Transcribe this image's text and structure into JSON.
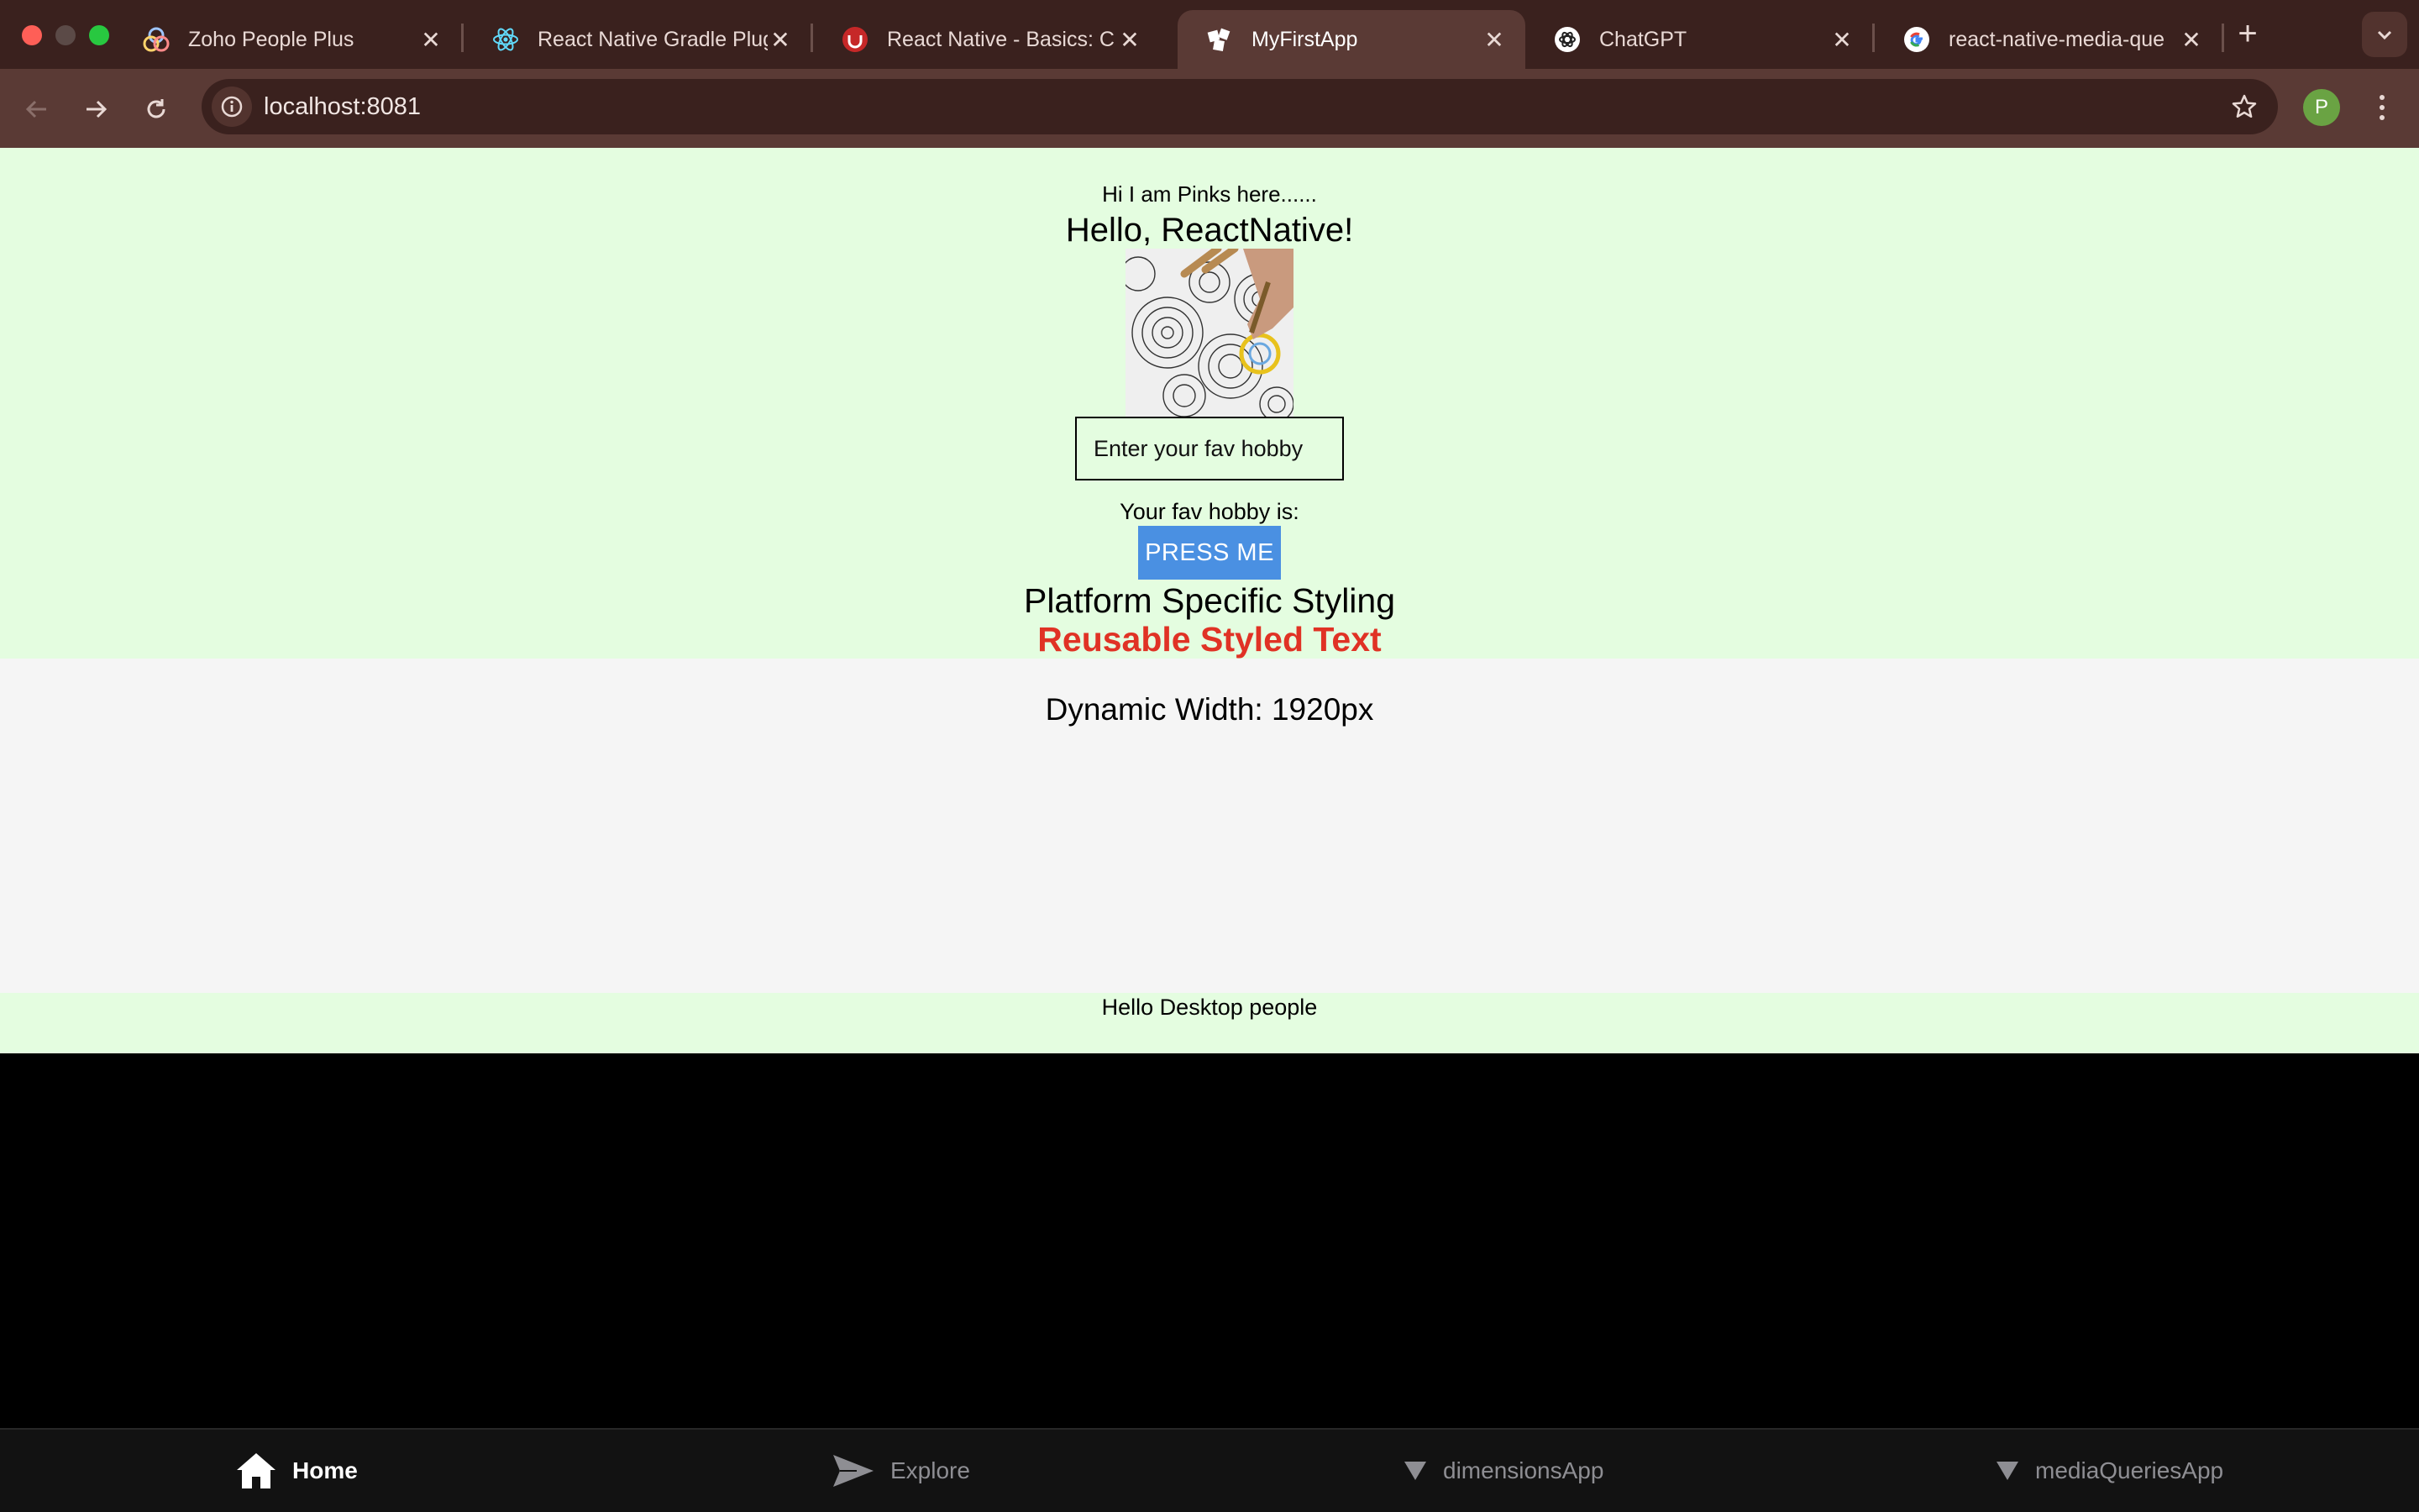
{
  "browser": {
    "tabs": [
      {
        "title": "Zoho People Plus",
        "icon": "zoho-icon",
        "active": false
      },
      {
        "title": "React Native Gradle Plug",
        "icon": "react-icon",
        "active": false
      },
      {
        "title": "React Native - Basics: C",
        "icon": "udemy-icon",
        "active": false
      },
      {
        "title": "MyFirstApp",
        "icon": "expo-icon",
        "active": true
      },
      {
        "title": "ChatGPT",
        "icon": "chatgpt-icon",
        "active": false
      },
      {
        "title": "react-native-media-que",
        "icon": "google-icon",
        "active": false
      }
    ],
    "url": "localhost:8081",
    "profile_initial": "P"
  },
  "app": {
    "intro": "Hi I am Pinks here......",
    "heading": "Hello, ReactNative!",
    "input_placeholder": "Enter your fav hobby",
    "fav_label": "Your fav hobby is:",
    "button_label": "PRESS ME",
    "platform_text": "Platform Specific Styling",
    "reusable_text": "Reusable Styled Text",
    "dynamic_width": "Dynamic Width: 1920px",
    "desktop_text": "Hello Desktop people"
  },
  "bottom_nav": {
    "items": [
      {
        "label": "Home",
        "icon": "home-icon",
        "active": true
      },
      {
        "label": "Explore",
        "icon": "send-icon",
        "active": false
      },
      {
        "label": "dimensionsApp",
        "icon": "triangle-down-icon",
        "active": false
      },
      {
        "label": "mediaQueriesApp",
        "icon": "triangle-down-icon",
        "active": false
      }
    ]
  },
  "colors": {
    "tabbar_bg": "#3a211e",
    "toolbar_bg": "#5a3a35",
    "page_green": "#e4fde0",
    "page_grey": "#f5f5f5",
    "button_blue": "#4a90e2",
    "reusable_red": "#e03225",
    "profile_green": "#6aa343"
  }
}
